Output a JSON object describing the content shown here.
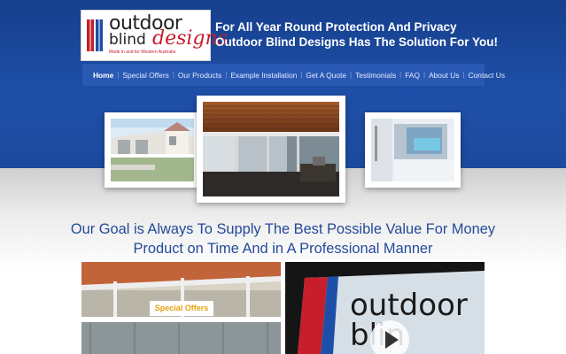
{
  "logo": {
    "word1": "outdoor",
    "word2": "blind",
    "word3": "designs",
    "tagline": "Made in and for Western Australia",
    "brand_red": "#c61e2b"
  },
  "header": {
    "line1": "For All Year Round Protection And Privacy",
    "line2": "Outdoor Blind Designs Has The Solution For You!"
  },
  "nav": {
    "items": [
      {
        "label": "Home",
        "active": true
      },
      {
        "label": "Special Offers"
      },
      {
        "label": "Our Products"
      },
      {
        "label": "Example Installation"
      },
      {
        "label": "Get A Quote"
      },
      {
        "label": "Testimonials"
      },
      {
        "label": "FAQ"
      },
      {
        "label": "About Us"
      },
      {
        "label": "Contact Us"
      }
    ],
    "separator": "|"
  },
  "slider": {
    "images": [
      "house-with-outdoor-blinds",
      "patio-with-clear-blinds",
      "blinds-by-pool"
    ]
  },
  "goal": {
    "line1": "Our Goal is Always To Supply The Best Possible Value For Money",
    "line2": "Product on Time And in A Professional Manner"
  },
  "promo": {
    "label": "Special Offers"
  },
  "video": {
    "overlay_text": "outdoor\nblin"
  },
  "colors": {
    "header_blue": "#1e4fa8",
    "nav_blue": "#2a59b4",
    "goal_text": "#254a99",
    "offer_gold": "#e5a10c"
  }
}
